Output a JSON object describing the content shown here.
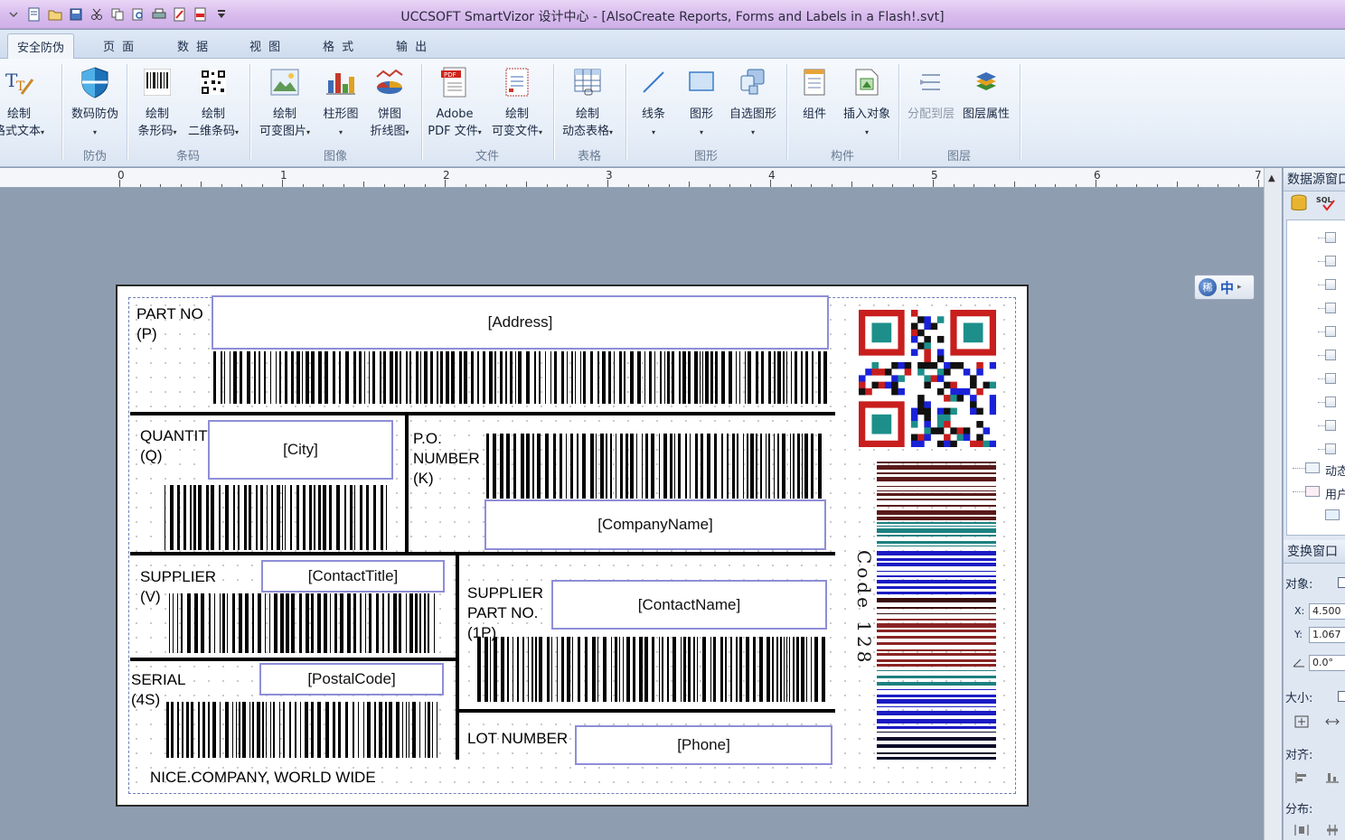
{
  "window": {
    "title": "UCCSOFT SmartVizor 设计中心 - [AlsoCreate Reports, Forms and Labels in a Flash!.svt]"
  },
  "tabs": [
    "安全防伪",
    "页 面",
    "数 据",
    "视 图",
    "格 式",
    "输 出"
  ],
  "ribbon": {
    "buttons": [
      {
        "line1": "绘制",
        "line2": "格式文本",
        "icon": "rich-text-icon"
      },
      {
        "line1": "数码防伪",
        "line2": "",
        "icon": "shield-icon"
      },
      {
        "line1": "绘制",
        "line2": "条形码",
        "icon": "barcode-icon"
      },
      {
        "line1": "绘制",
        "line2": "二维条码",
        "icon": "qrcode-icon"
      },
      {
        "line1": "绘制",
        "line2": "可变图片",
        "icon": "image-icon"
      },
      {
        "line1": "柱形图",
        "line2": "",
        "icon": "bar-chart-icon"
      },
      {
        "line1": "饼图",
        "line2": "折线图",
        "icon": "pie-chart-icon"
      },
      {
        "line1": "Adobe",
        "line2": "PDF 文件",
        "icon": "pdf-icon"
      },
      {
        "line1": "绘制",
        "line2": "可变文件",
        "icon": "variable-file-icon"
      },
      {
        "line1": "绘制",
        "line2": "动态表格",
        "icon": "table-icon"
      },
      {
        "line1": "线条",
        "line2": "",
        "icon": "line-icon"
      },
      {
        "line1": "图形",
        "line2": "",
        "icon": "rectangle-icon"
      },
      {
        "line1": "自选图形",
        "line2": "",
        "icon": "custom-shape-icon"
      },
      {
        "line1": "组件",
        "line2": "",
        "icon": "component-icon"
      },
      {
        "line1": "插入对象",
        "line2": "",
        "icon": "insert-object-icon"
      },
      {
        "line1": "分配到层",
        "line2": "",
        "icon": "assign-layer-icon"
      },
      {
        "line1": "图层属性",
        "line2": "",
        "icon": "layer-properties-icon"
      }
    ],
    "groups": [
      "防伪",
      "条码",
      "图像",
      "文件",
      "表格",
      "图形",
      "构件",
      "图层"
    ]
  },
  "ruler": {
    "numbers": [
      "0",
      "1",
      "2",
      "3",
      "4",
      "5",
      "6",
      "7"
    ]
  },
  "label": {
    "part_no": "PART NO\n(P)",
    "address": "[Address]",
    "quantity": "QUANTITY\n(Q)",
    "city": "[City]",
    "po_number": "P.O.\nNUMBER\n(K)",
    "company_name": "[CompanyName]",
    "supplier": "SUPPLIER\n(V)",
    "contact_title": "[ContactTitle]",
    "supplier_part": "SUPPLIER\nPART NO.\n(1P)",
    "contact_name": "[ContactName]",
    "serial": "SERIAL\n(4S)",
    "postal_code": "[PostalCode]",
    "lot_number": "LOT NUMBER",
    "phone": "[Phone]",
    "footer": "NICE.COMPANY, WORLD WIDE",
    "code128_caption": "Code 128"
  },
  "ime": {
    "label": "中"
  },
  "right_panel": {
    "datasource_title": "数据源窗口",
    "tree_items": [
      "动态",
      "用户"
    ],
    "transform_title": "变换窗口",
    "object_label": "对象:",
    "x_label": "X:",
    "x_value": "4.500",
    "y_label": "Y:",
    "y_value": "1.067",
    "angle_value": "0.0°",
    "size_label": "大小:",
    "align_label": "对齐:",
    "distribute_label": "分布:"
  },
  "colors": {
    "title_bar": "#d9bdee",
    "ribbon_bg": "#e6eef8",
    "canvas_bg": "#8f9db1",
    "field_border": "#8e8ed8"
  }
}
